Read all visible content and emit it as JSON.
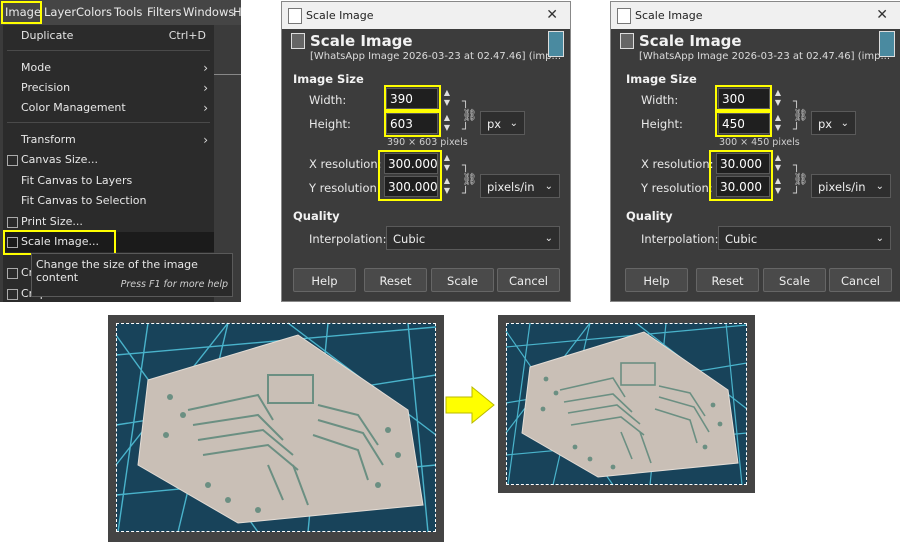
{
  "menubar": [
    "Image",
    "Layer",
    "Colors",
    "Tools",
    "Filters",
    "Windows",
    "H"
  ],
  "menu_items": [
    {
      "label": "Duplicate",
      "shortcut": "Ctrl+D"
    },
    {
      "label": "Mode"
    },
    {
      "label": "Precision"
    },
    {
      "label": "Color Management"
    },
    {
      "label": "Transform"
    },
    {
      "label": "Canvas Size..."
    },
    {
      "label": "Fit Canvas to Layers"
    },
    {
      "label": "Fit Canvas to Selection"
    },
    {
      "label": "Print Size..."
    },
    {
      "label": "Scale Image..."
    },
    {
      "label": "Cr"
    },
    {
      "label": "Crop to Content"
    }
  ],
  "tooltip": {
    "text": "Change the size of the image content",
    "hint": "Press F1 for more help"
  },
  "dialog_common": {
    "window_title": "Scale Image",
    "header": "Scale Image",
    "subtitle": "[WhatsApp Image 2026-03-23 at 02.47.46] (imp...",
    "image_size_label": "Image Size",
    "width_label": "Width:",
    "height_label": "Height:",
    "xres_label": "X resolution:",
    "yres_label": "Y resolution:",
    "quality_label": "Quality",
    "interp_label": "Interpolation:",
    "interp_value": "Cubic",
    "size_unit": "px",
    "res_unit": "pixels/in",
    "buttons": [
      "Help",
      "Reset",
      "Scale",
      "Cancel"
    ],
    "close_glyph": "✕"
  },
  "dialog_before": {
    "width": "390",
    "height": "603",
    "pixels": "390 × 603 pixels",
    "xres": "300.000",
    "yres": "300.000"
  },
  "dialog_after": {
    "width": "300",
    "height": "450",
    "pixels": "300 × 450 pixels",
    "xres": "30.000",
    "yres": "30.000"
  },
  "highlight_color": "#ffff00",
  "arrow_color": "#ffff00"
}
